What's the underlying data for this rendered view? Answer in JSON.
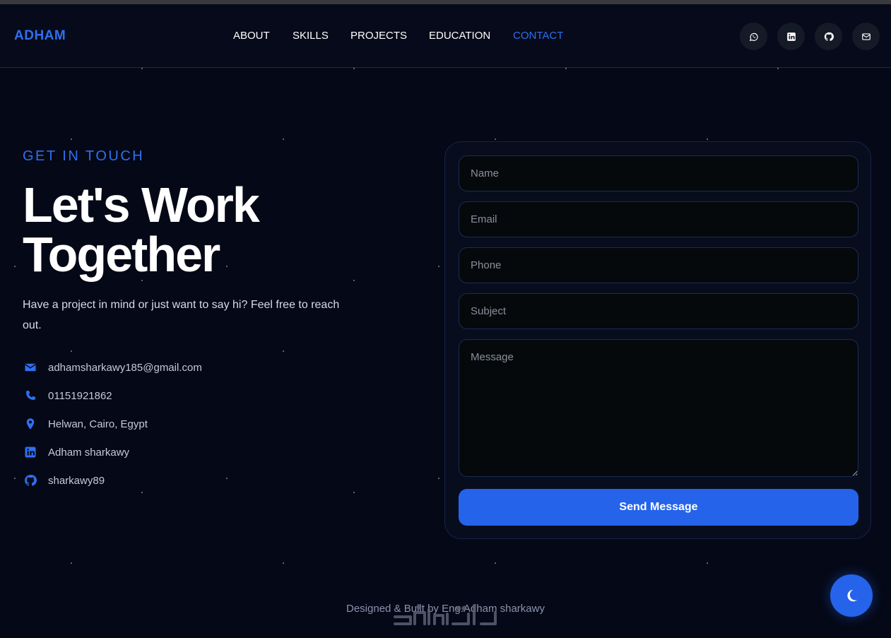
{
  "brand": {
    "logo": "ADHAM"
  },
  "nav": {
    "links": [
      "ABOUT",
      "SKILLS",
      "PROJECTS",
      "EDUCATION",
      "CONTACT"
    ],
    "active": "CONTACT"
  },
  "social": [
    "whatsapp-icon",
    "linkedin-icon",
    "github-icon",
    "mail-icon"
  ],
  "hero": {
    "eyebrow": "GET IN TOUCH",
    "headline_line1": "Let's Work",
    "headline_line2": "Together",
    "intro": "Have a project in mind or just want to say hi? Feel free to reach out."
  },
  "contact": {
    "items": [
      {
        "icon": "envelope-icon",
        "text": "adhamsharkawy185@gmail.com"
      },
      {
        "icon": "phone-icon",
        "text": "01151921862"
      },
      {
        "icon": "map-pin-icon",
        "text": "Helwan, Cairo, Egypt"
      },
      {
        "icon": "linkedin-icon",
        "text": "Adham sharkawy"
      },
      {
        "icon": "github-icon",
        "text": "sharkawy89"
      }
    ]
  },
  "form": {
    "name_placeholder": "Name",
    "email_placeholder": "Email",
    "phone_placeholder": "Phone",
    "subject_placeholder": "Subject",
    "message_placeholder": "Message",
    "submit_label": "Send Message"
  },
  "footer": {
    "text": "Designed & Built by Eng.Adham sharkawy"
  },
  "colors": {
    "accent": "#2f6ff0",
    "button": "#2563eb",
    "background": "#050816"
  }
}
